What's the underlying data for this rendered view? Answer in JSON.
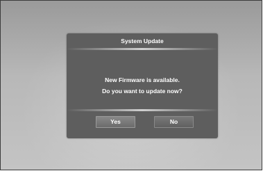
{
  "dialog": {
    "title": "System Update",
    "message_line1": "New Firmware is available.",
    "message_line2": "Do you want to update now?",
    "yes_label": "Yes",
    "no_label": "No"
  },
  "colors": {
    "dialog_background": "#5e5e5e",
    "screen_background": "#b8b8b8",
    "text": "#ffffff",
    "yes_button": "#7a7a7a",
    "no_button": "#6b6b6b"
  }
}
